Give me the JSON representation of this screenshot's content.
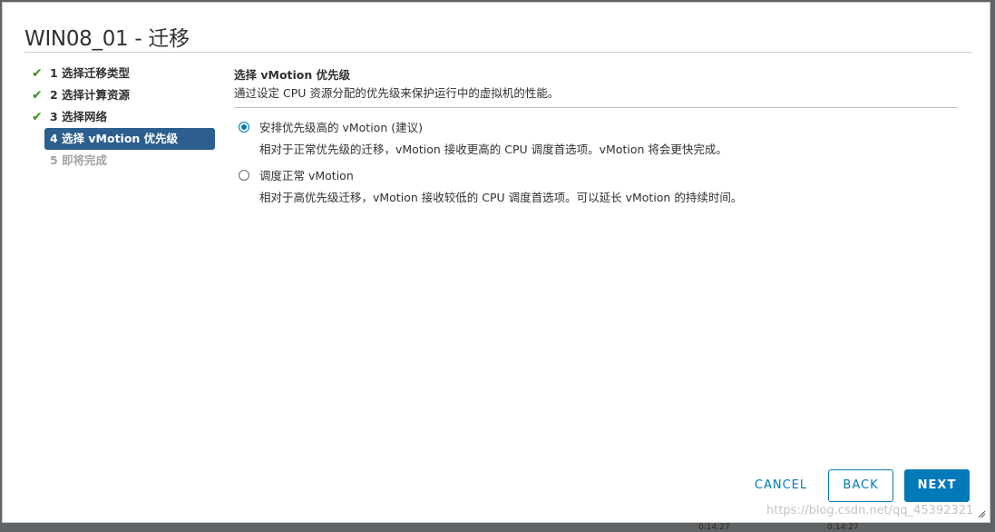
{
  "dialog": {
    "title": "WIN08_01 - 迁移"
  },
  "steps": [
    {
      "label": "1 选择迁移类型",
      "status": "done"
    },
    {
      "label": "2 选择计算资源",
      "status": "done"
    },
    {
      "label": "3 选择网络",
      "status": "done"
    },
    {
      "label": "4 选择 vMotion 优先级",
      "status": "current"
    },
    {
      "label": "5 即将完成",
      "status": "pending"
    }
  ],
  "icons": {
    "check": "check-icon",
    "resize": "resize-handle-icon"
  },
  "content": {
    "title": "选择 vMotion 优先级",
    "description": "通过设定 CPU 资源分配的优先级来保护运行中的虚拟机的性能。",
    "options": [
      {
        "label": "安排优先级高的 vMotion (建议)",
        "description": "相对于正常优先级的迁移，vMotion 接收更高的 CPU 调度首选项。vMotion 将会更快完成。",
        "selected": true
      },
      {
        "label": "调度正常 vMotion",
        "description": "相对于高优先级迁移，vMotion 接收较低的 CPU 调度首选项。可以延长 vMotion 的持续时间。",
        "selected": false
      }
    ]
  },
  "footer": {
    "cancel_label": "CANCEL",
    "back_label": "BACK",
    "next_label": "NEXT"
  },
  "watermark": "https://blog.csdn.net/qq_45392321",
  "background": {
    "time_left": "0:14:27",
    "time_right": "0:14:27"
  },
  "colors": {
    "accent": "#0079b8",
    "current_step_bg": "#2c5e8e",
    "check": "#3c8f26",
    "pending_text": "#a4a4a4"
  }
}
